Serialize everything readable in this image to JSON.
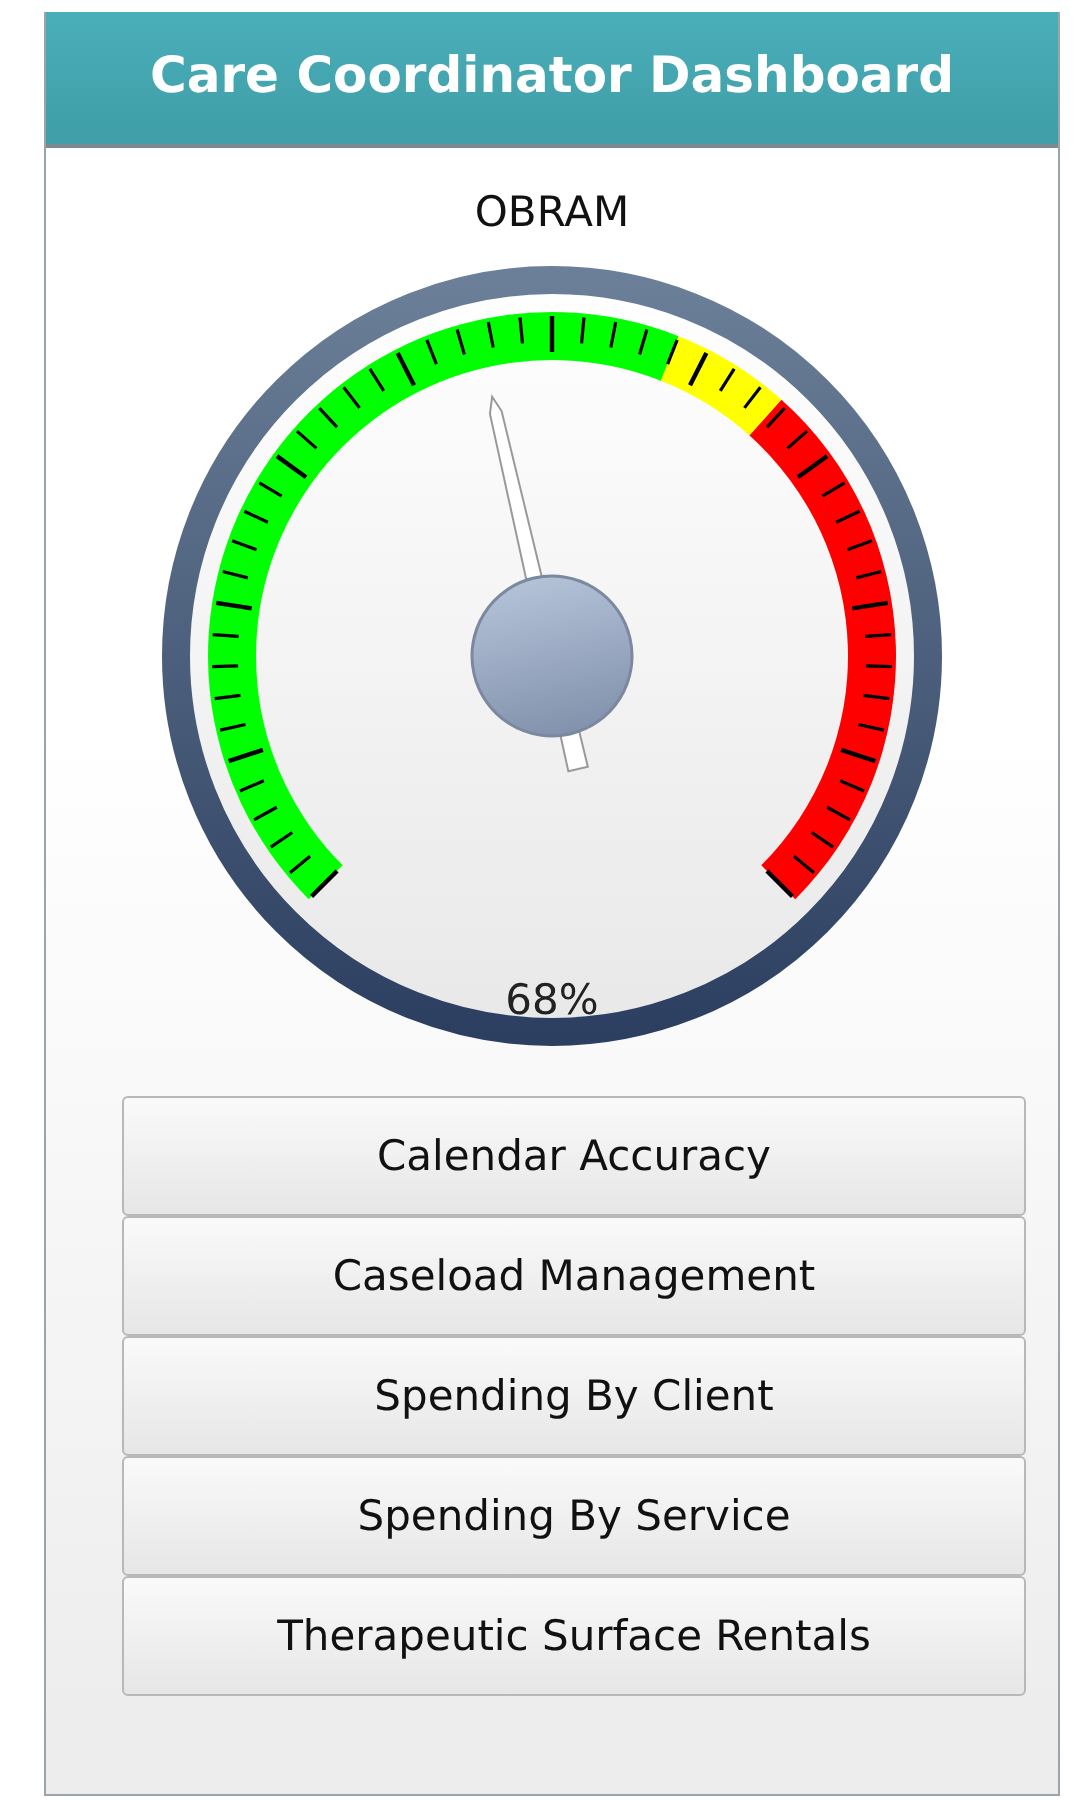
{
  "header": {
    "title": "Care Coordinator Dashboard"
  },
  "gauge": {
    "title": "OBRAM",
    "reading": "68%"
  },
  "buttons": [
    {
      "label": "Calendar Accuracy"
    },
    {
      "label": "Caseload Management"
    },
    {
      "label": "Spending By Client"
    },
    {
      "label": "Spending By Service"
    },
    {
      "label": "Therapeutic Surface Rentals"
    }
  ]
}
